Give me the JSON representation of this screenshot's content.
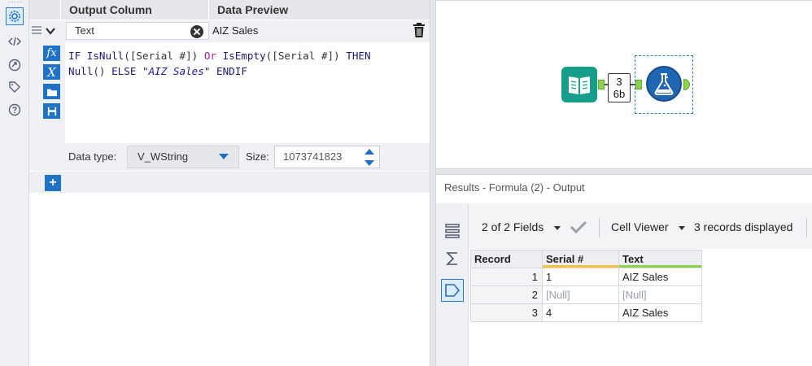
{
  "rail": {
    "icons": [
      "settings-icon",
      "code-icon",
      "annotation-icon",
      "tag-icon",
      "help-icon"
    ],
    "accent": "#2a7fc9"
  },
  "config": {
    "headers": {
      "output_column": "Output Column",
      "data_preview": "Data Preview"
    },
    "output_field": {
      "value": "Text"
    },
    "preview_value": "AIZ Sales",
    "formula_tools": [
      "fx",
      "X",
      "folder-icon",
      "save-icon"
    ],
    "expression_lines": [
      [
        {
          "t": "IF ",
          "c": "kw"
        },
        {
          "t": "IsNull",
          "c": "fn"
        },
        {
          "t": "([Serial #]) ",
          "c": "br"
        },
        {
          "t": "Or ",
          "c": "op"
        },
        {
          "t": "IsEmpty",
          "c": "fn"
        },
        {
          "t": "([Serial #]) ",
          "c": "br"
        },
        {
          "t": "THEN",
          "c": "kw"
        }
      ],
      [
        {
          "t": "Null",
          "c": "fn"
        },
        {
          "t": "() ",
          "c": "br"
        },
        {
          "t": "ELSE ",
          "c": "kw"
        },
        {
          "t": "\"AIZ Sales\"",
          "c": "str"
        },
        {
          "t": " ENDIF",
          "c": "kw"
        }
      ]
    ],
    "data_type": {
      "label": "Data type:",
      "value": "V_WString"
    },
    "size": {
      "label": "Size:",
      "value": "1073741823"
    },
    "add_label": "+"
  },
  "canvas": {
    "connection_badge": {
      "line1": "3",
      "line2": "6b"
    },
    "input_color": "#179e8a",
    "formula_color": "#1f66b3",
    "anchor_color": "#8fd14f"
  },
  "results": {
    "title": "Results - Formula (2) - Output",
    "fields_count": "2 of 2 Fields",
    "cell_viewer": "Cell Viewer",
    "records_count": "3 records displayed",
    "columns": [
      {
        "name": "Record",
        "underline": ""
      },
      {
        "name": "Serial #",
        "underline": "#f5c242"
      },
      {
        "name": "Text",
        "underline": "#8fd14f"
      }
    ],
    "rows": [
      {
        "record": "1",
        "serial": "1",
        "text": "AIZ Sales",
        "null": false
      },
      {
        "record": "2",
        "serial": "[Null]",
        "text": "[Null]",
        "null": true
      },
      {
        "record": "3",
        "serial": "4",
        "text": "AIZ Sales",
        "null": false
      }
    ]
  }
}
